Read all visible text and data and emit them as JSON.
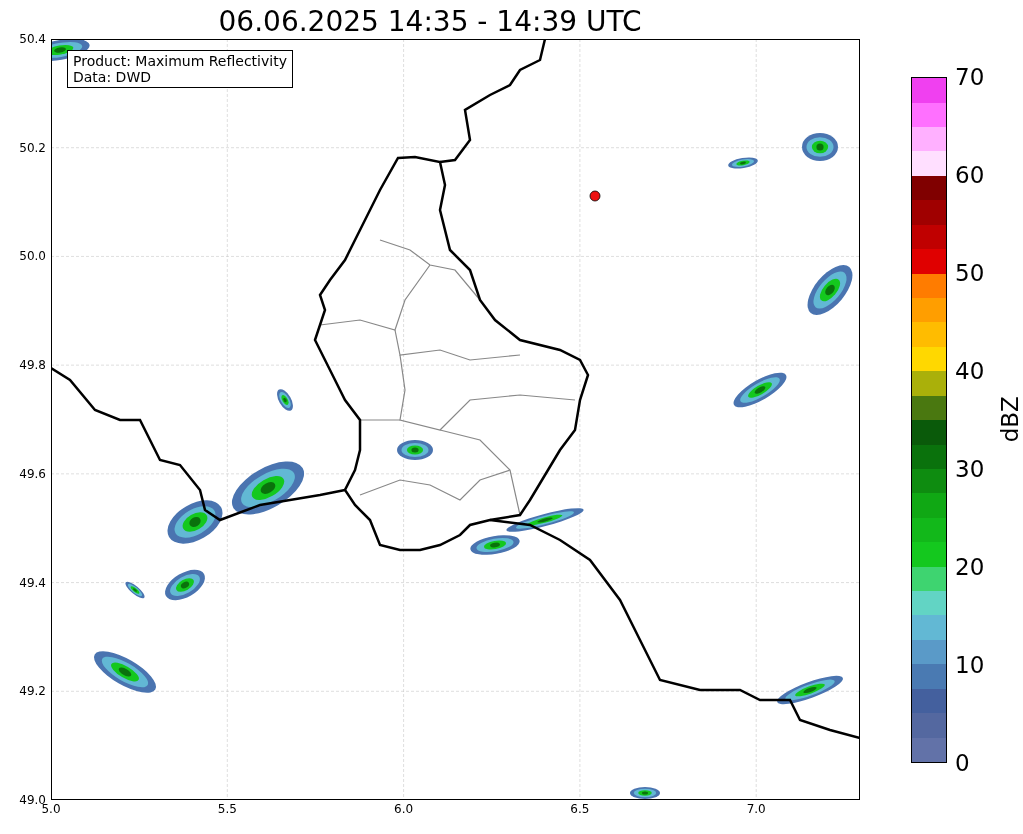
{
  "title": "06.06.2025 14:35 - 14:39 UTC",
  "map": {
    "info_lines": [
      "Product: Maximum Reflectivity",
      "Data: DWD"
    ],
    "yticks": [
      "50.4",
      "50.2",
      "50.0",
      "49.8",
      "49.6",
      "49.4",
      "49.2",
      "49.0"
    ],
    "xticks": [
      "5.0",
      "5.5",
      "6.0",
      "6.5",
      "7.0"
    ]
  },
  "colorbar": {
    "label": "dBZ",
    "ticks": [
      "70",
      "60",
      "50",
      "40",
      "30",
      "20",
      "10",
      "0"
    ],
    "bands": [
      {
        "color": "#6272a8"
      },
      {
        "color": "#5468a0"
      },
      {
        "color": "#44609e"
      },
      {
        "color": "#4a7ab2"
      },
      {
        "color": "#5a9ac8"
      },
      {
        "color": "#62b8d4"
      },
      {
        "color": "#62d4c4"
      },
      {
        "color": "#3ed470"
      },
      {
        "color": "#14c81e"
      },
      {
        "color": "#12b81a"
      },
      {
        "color": "#10a814"
      },
      {
        "color": "#0e8c10"
      },
      {
        "color": "#0a720c"
      },
      {
        "color": "#0a5a0a"
      },
      {
        "color": "#4a7810"
      },
      {
        "color": "#aab00a"
      },
      {
        "color": "#ffd800"
      },
      {
        "color": "#ffbc00"
      },
      {
        "color": "#ff9e00"
      },
      {
        "color": "#ff7c00"
      },
      {
        "color": "#e00000"
      },
      {
        "color": "#c00000"
      },
      {
        "color": "#a00000"
      },
      {
        "color": "#800000"
      },
      {
        "color": "#ffdfff"
      },
      {
        "color": "#ffb0ff"
      },
      {
        "color": "#ff70ff"
      },
      {
        "color": "#f040f0"
      }
    ]
  }
}
